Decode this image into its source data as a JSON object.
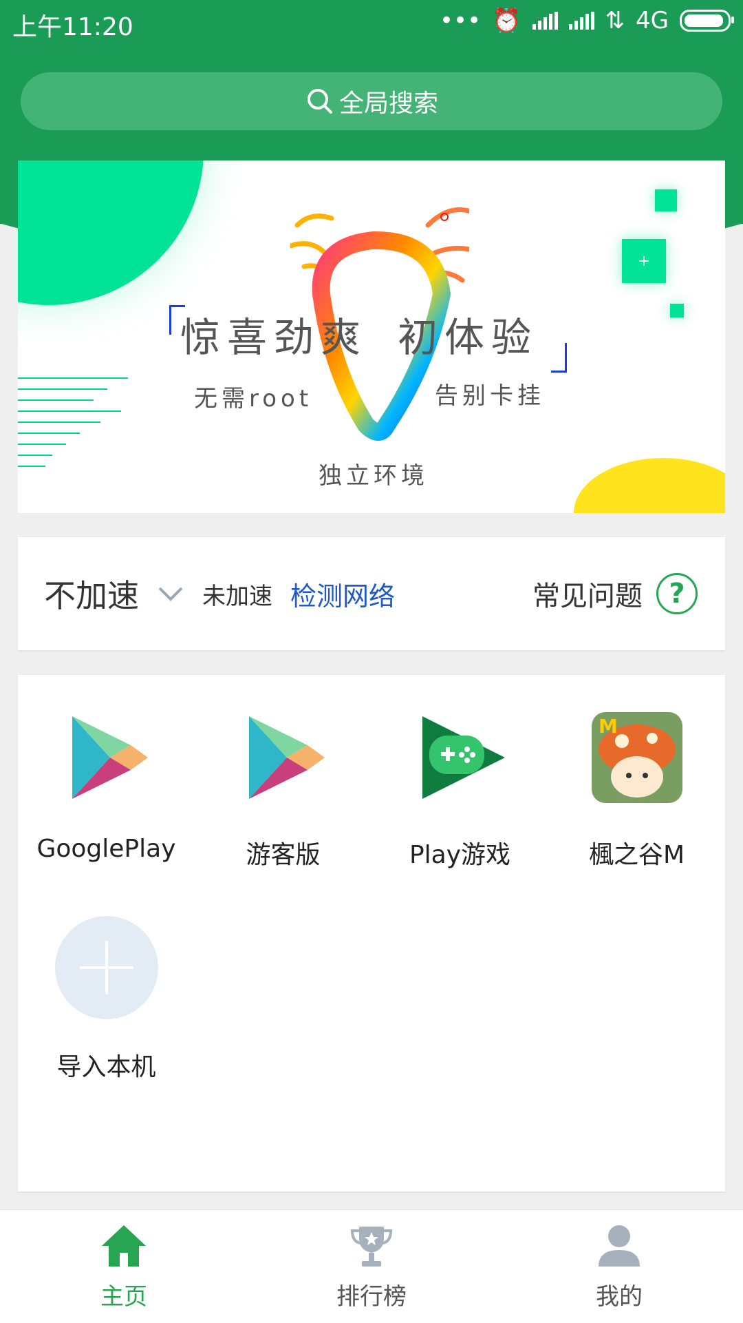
{
  "status_bar": {
    "time": "上午11:20",
    "network": "4G"
  },
  "search": {
    "label": "全局搜索"
  },
  "banner": {
    "headline_a": "惊喜劲爽",
    "headline_b": "初体验",
    "sub_left": "无需root",
    "sub_right": "告别卡挂",
    "sub_bottom": "独立环境",
    "square_symbol": "+"
  },
  "acceleration": {
    "mode": "不加速",
    "status": "未加速",
    "detect": "检测网络",
    "faq": "常见问题",
    "help_symbol": "?"
  },
  "apps": [
    {
      "label": "GooglePlay",
      "icon": "google-play-icon"
    },
    {
      "label": "游客版",
      "icon": "google-play-icon"
    },
    {
      "label": "Play游戏",
      "icon": "play-games-icon"
    },
    {
      "label": "楓之谷M",
      "icon": "maplestory-icon"
    },
    {
      "label": "导入本机",
      "icon": "add-icon"
    }
  ],
  "nav": {
    "home": "主页",
    "rank": "排行榜",
    "mine": "我的"
  },
  "colors": {
    "primary_green": "#1a9b56",
    "accent_blue": "#1e58c9",
    "banner_green": "#00e296",
    "banner_yellow": "#ffe41d"
  }
}
